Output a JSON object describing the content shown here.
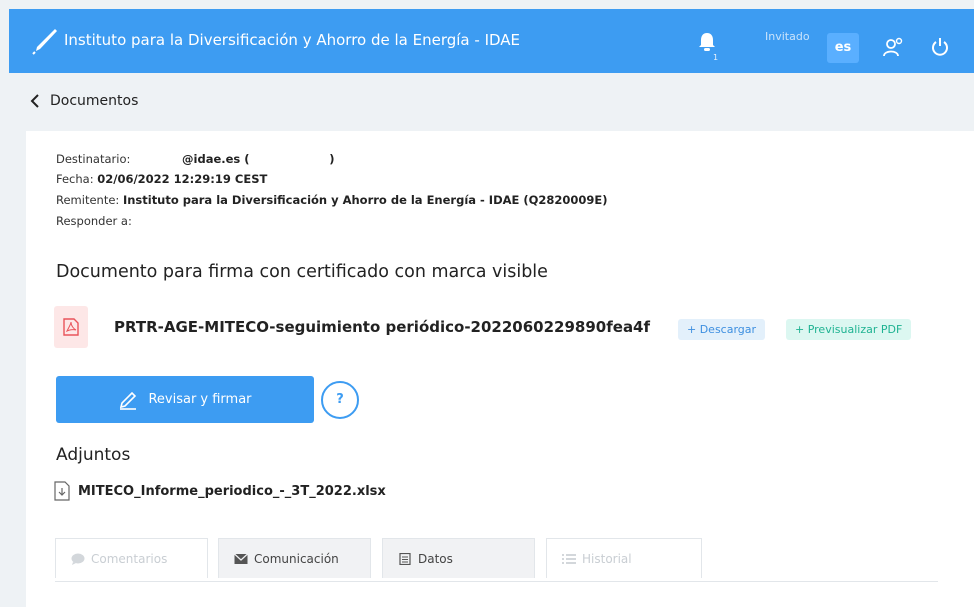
{
  "header": {
    "title": "Instituto para la Diversificación y Ahorro de la Energía - IDAE",
    "notifications_count": "1",
    "user_role": "Invitado",
    "language": "es"
  },
  "breadcrumb": {
    "label": "Documentos"
  },
  "message": {
    "recipient_label": "Destinatario:",
    "recipient_value": "@idae.es (",
    "recipient_close": ")",
    "date_label": "Fecha:",
    "date_value": "02/06/2022 12:29:19 CEST",
    "sender_label": "Remitente:",
    "sender_value": "Instituto para la Diversificación y Ahorro de la Energía - IDAE (Q2820009E)",
    "reply_label": "Responder a:"
  },
  "document": {
    "title": "Documento para firma con certificado con marca visible",
    "file_name": "PRTR-AGE-MITECO-seguimiento periódico-2022060229890fea4f",
    "download_label": "+ Descargar",
    "preview_label": "+ Previsualizar PDF"
  },
  "actions": {
    "sign_label": "Revisar y firmar",
    "help_label": "?"
  },
  "attachments": {
    "title": "Adjuntos",
    "items": [
      {
        "name": "MITECO_Informe_periodico_-_3T_2022.xlsx"
      }
    ]
  },
  "tabs": [
    {
      "label": "Comentarios",
      "icon": "comment-icon",
      "state": "disabled"
    },
    {
      "label": "Comunicación",
      "icon": "envelope-icon",
      "state": "active"
    },
    {
      "label": "Datos",
      "icon": "document-icon",
      "state": "active"
    },
    {
      "label": "Historial",
      "icon": "list-icon",
      "state": "disabled"
    }
  ],
  "colors": {
    "primary": "#3d9cf2",
    "pdf_bg": "#fde7e7",
    "download_bg": "#e3f0fb",
    "preview_bg": "#dcf7f1"
  }
}
